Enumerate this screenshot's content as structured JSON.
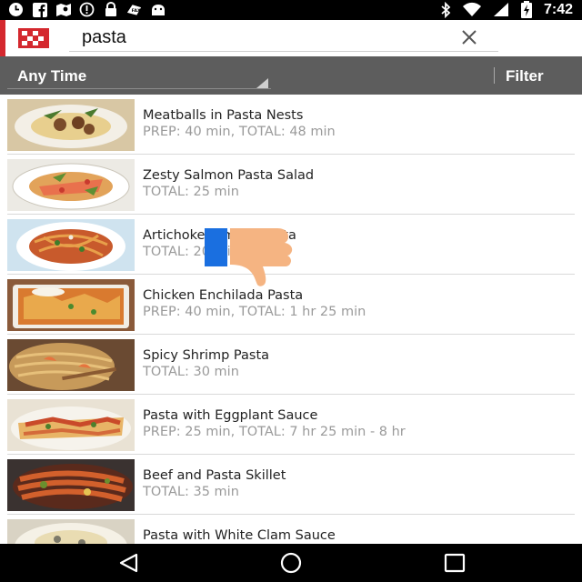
{
  "status_bar": {
    "time": "7:42",
    "left_icons": [
      "clock-icon",
      "facebook-icon",
      "map-icon",
      "circle-icon",
      "lock-icon",
      "fax-icon",
      "android-icon"
    ],
    "right_icons": [
      "bluetooth-icon",
      "wifi-icon",
      "signal-icon",
      "battery-icon"
    ]
  },
  "search": {
    "query": "pasta"
  },
  "filter_bar": {
    "time_filter": "Any Time",
    "filter_label": "Filter"
  },
  "recipes": [
    {
      "title": "Meatballs in Pasta Nests",
      "time": "PREP: 40 min, TOTAL: 48 min"
    },
    {
      "title": "Zesty Salmon Pasta Salad",
      "time": "TOTAL: 25 min"
    },
    {
      "title": "Artichoke-Tomato Pasta",
      "time": "TOTAL: 20 min"
    },
    {
      "title": "Chicken Enchilada Pasta",
      "time": "PREP: 40 min, TOTAL: 1 hr 25 min"
    },
    {
      "title": "Spicy Shrimp Pasta",
      "time": "TOTAL: 30 min"
    },
    {
      "title": "Pasta with Eggplant Sauce",
      "time": "PREP: 25 min, TOTAL: 7 hr 25 min - 8 hr"
    },
    {
      "title": "Beef and Pasta Skillet",
      "time": "TOTAL: 35 min"
    },
    {
      "title": "Pasta with White Clam Sauce",
      "time": ""
    }
  ],
  "overlay": {
    "icon": "thumbs-down-icon"
  },
  "nav_bar": {
    "buttons": [
      "back-icon",
      "home-icon",
      "recents-icon"
    ]
  },
  "colors": {
    "accent_red": "#d4282e",
    "filter_bar_bg": "#5d5d5d",
    "status_bar_bg": "#000000",
    "overlay_blue": "#1a6fe0",
    "overlay_skin": "#f5b482"
  }
}
